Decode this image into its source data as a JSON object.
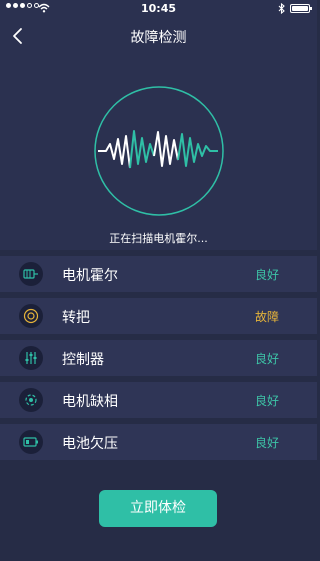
{
  "status_bar": {
    "time": "10:45"
  },
  "nav": {
    "title": "故障检测"
  },
  "scan": {
    "status_text": "正在扫描电机霍尔..."
  },
  "items": [
    {
      "label": "电机霍尔",
      "status": "良好",
      "status_color": "#3dc4a7",
      "icon": "motor-icon"
    },
    {
      "label": "转把",
      "status": "故障",
      "status_color": "#e6b43a",
      "icon": "throttle-icon"
    },
    {
      "label": "控制器",
      "status": "良好",
      "status_color": "#3dc4a7",
      "icon": "controller-icon"
    },
    {
      "label": "电机缺相",
      "status": "良好",
      "status_color": "#3dc4a7",
      "icon": "phase-icon"
    },
    {
      "label": "电池欠压",
      "status": "良好",
      "status_color": "#3dc4a7",
      "icon": "battery-icon"
    }
  ],
  "actions": {
    "check_label": "立即体检"
  },
  "colors": {
    "accent": "#2fbfa6",
    "background": "#262c46",
    "warning": "#e6b43a"
  }
}
